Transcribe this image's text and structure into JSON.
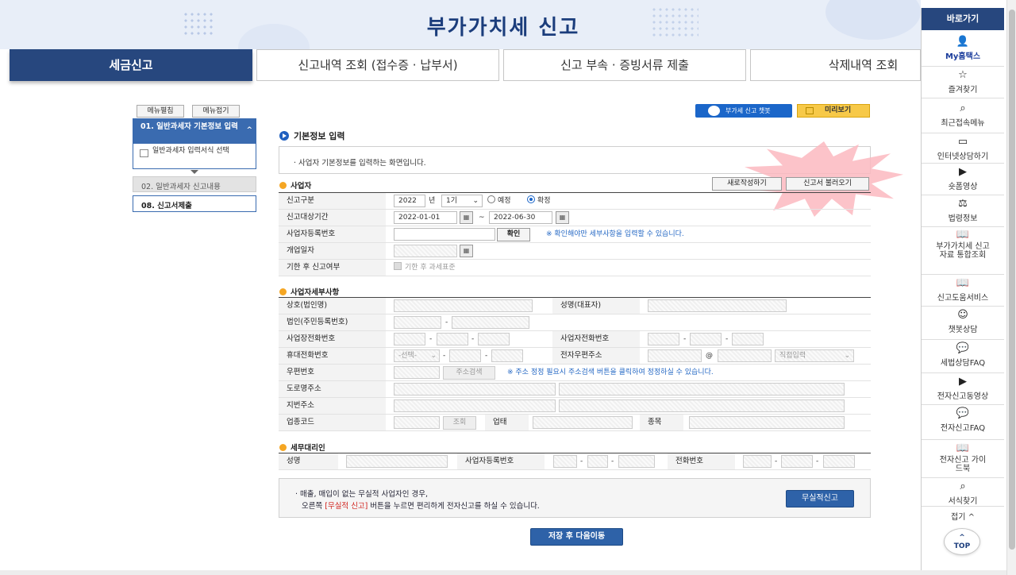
{
  "page": {
    "title": "부가가치세 신고"
  },
  "tabs": [
    {
      "label": "세금신고",
      "active": true
    },
    {
      "label": "신고내역 조회 (접수증 · 납부서)"
    },
    {
      "label": "신고 부속 · 증빙서류 제출"
    },
    {
      "label": "삭제내역 조회"
    }
  ],
  "left_menu": {
    "expand": "메뉴펼침",
    "collapse": "메뉴접기",
    "step1": "01. 일반과세자 기본정보 입력",
    "step1_sub": "일반과세자 입력서식 선택",
    "step2": "02. 일반과세자 신고내용",
    "step3": "08. 신고서제출"
  },
  "top_buttons": {
    "chatbot": "부가세 신고 챗봇",
    "preview": "미리보기"
  },
  "section": {
    "title": "기본정보 입력",
    "info": "· 사업자 기본정보를 입력하는 화면입니다."
  },
  "business": {
    "heading": "사업자",
    "new_button": "새로작성하기",
    "load_button": "신고서 불러오기",
    "report_type_label": "신고구분",
    "year": "2022",
    "year_unit": "년",
    "period": "1기",
    "radio_plan": "예정",
    "radio_confirm": "확정",
    "period_label": "신고대상기간",
    "date_from": "2022-01-01",
    "tilde": "~",
    "date_to": "2022-06-30",
    "regno_label": "사업자등록번호",
    "confirm_button": "확인",
    "regno_hint": "※ 확인해야만 세부사항을 입력할 수 있습니다.",
    "open_label": "개업일자",
    "late_label": "기한 후 신고여부",
    "late_check": "기한 후 과세표준"
  },
  "details": {
    "heading": "사업자세부사항",
    "trade_name": "상호(법인명)",
    "rep_name": "성명(대표자)",
    "corp_no": "법인(주민등록번호)",
    "biz_phone": "사업장전화번호",
    "biz_phone2": "사업자전화번호",
    "mobile": "휴대전화번호",
    "mobile_select": "-선택-",
    "email": "전자우편주소",
    "at": "@",
    "email_domain": "직접입력",
    "zip": "우편번호",
    "zip_search": "주소검색",
    "zip_hint": "※ 주소 정정 필요시 주소검색 버튼을 클릭하여 정정하실 수 있습니다.",
    "road_addr": "도로명주소",
    "lot_addr": "지번주소",
    "industry_code": "업종코드",
    "lookup": "조회",
    "biz_type": "업태",
    "biz_item": "종목",
    "dash": "-"
  },
  "agent": {
    "heading": "세무대리인",
    "name": "성명",
    "regno": "사업자등록번호",
    "phone": "전화번호"
  },
  "bottom": {
    "line1": "· 매출, 매입이 없는 무실적 사업자인 경우,",
    "line2_pre": "오른쪽 ",
    "line2_red": "[무실적 신고]",
    "line2_post": " 버튼을 누르면 편리하게 전자신고를 하실 수 있습니다.",
    "noperf_button": "무실적신고",
    "save_next": "저장 후 다음이동"
  },
  "sidebar": {
    "title": "바로가기",
    "items": [
      {
        "label": "My홈택스",
        "icon": "person-icon"
      },
      {
        "label": "즐겨찾기",
        "icon": "star-icon"
      },
      {
        "label": "최근접속메뉴",
        "icon": "recent-menu-icon"
      },
      {
        "label": "인터넷상담하기",
        "icon": "laptop-icon"
      },
      {
        "label": "숏폼영상",
        "icon": "video-icon"
      },
      {
        "label": "법령정보",
        "icon": "gavel-icon"
      },
      {
        "label": "부가가치세 신고자료 통합조회",
        "icon": "book-icon"
      },
      {
        "label": "신고도움서비스",
        "icon": "book-icon"
      },
      {
        "label": "챗봇상담",
        "icon": "chatbot-icon"
      },
      {
        "label": "세법상담FAQ",
        "icon": "chat-icon"
      },
      {
        "label": "전자신고동영상",
        "icon": "video-icon"
      },
      {
        "label": "전자신고FAQ",
        "icon": "chat-icon"
      },
      {
        "label": "전자신고 가이드북",
        "icon": "book-icon"
      },
      {
        "label": "서식찾기",
        "icon": "search-icon"
      }
    ],
    "fold": "접기 ^",
    "top": "TOP"
  }
}
